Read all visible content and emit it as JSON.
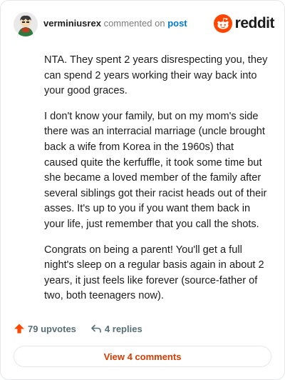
{
  "comment": {
    "username": "verminiusrex",
    "verb": "commented on",
    "link_text": "post",
    "paragraphs": [
      "NTA. They spent 2 years disrespecting you, they can spend 2 years working their way back into your good graces.",
      "I don't know your family, but on my mom's side there was an interracial marriage (uncle brought back a wife from Korea in the 1960s) that caused quite the kerfuffle, it took some time but she became a loved member of the family after several siblings got their racist heads out of their asses. It's up to you if you want them back in your life, just remember that you call the shots.",
      "Congrats on being a parent! You'll get a full night's sleep on a regular basis again in about 2 years, it just feels like forever (source-father of two, both teenagers now)."
    ],
    "upvotes_label": "79 upvotes",
    "replies_label": "4 replies",
    "view_comments_label": "View 4 comments"
  },
  "brand": {
    "wordmark": "reddit",
    "icon": "reddit-snoo-icon",
    "accent_color": "#ff4500",
    "link_color": "#0079d3",
    "button_text_color": "#d93a00"
  }
}
